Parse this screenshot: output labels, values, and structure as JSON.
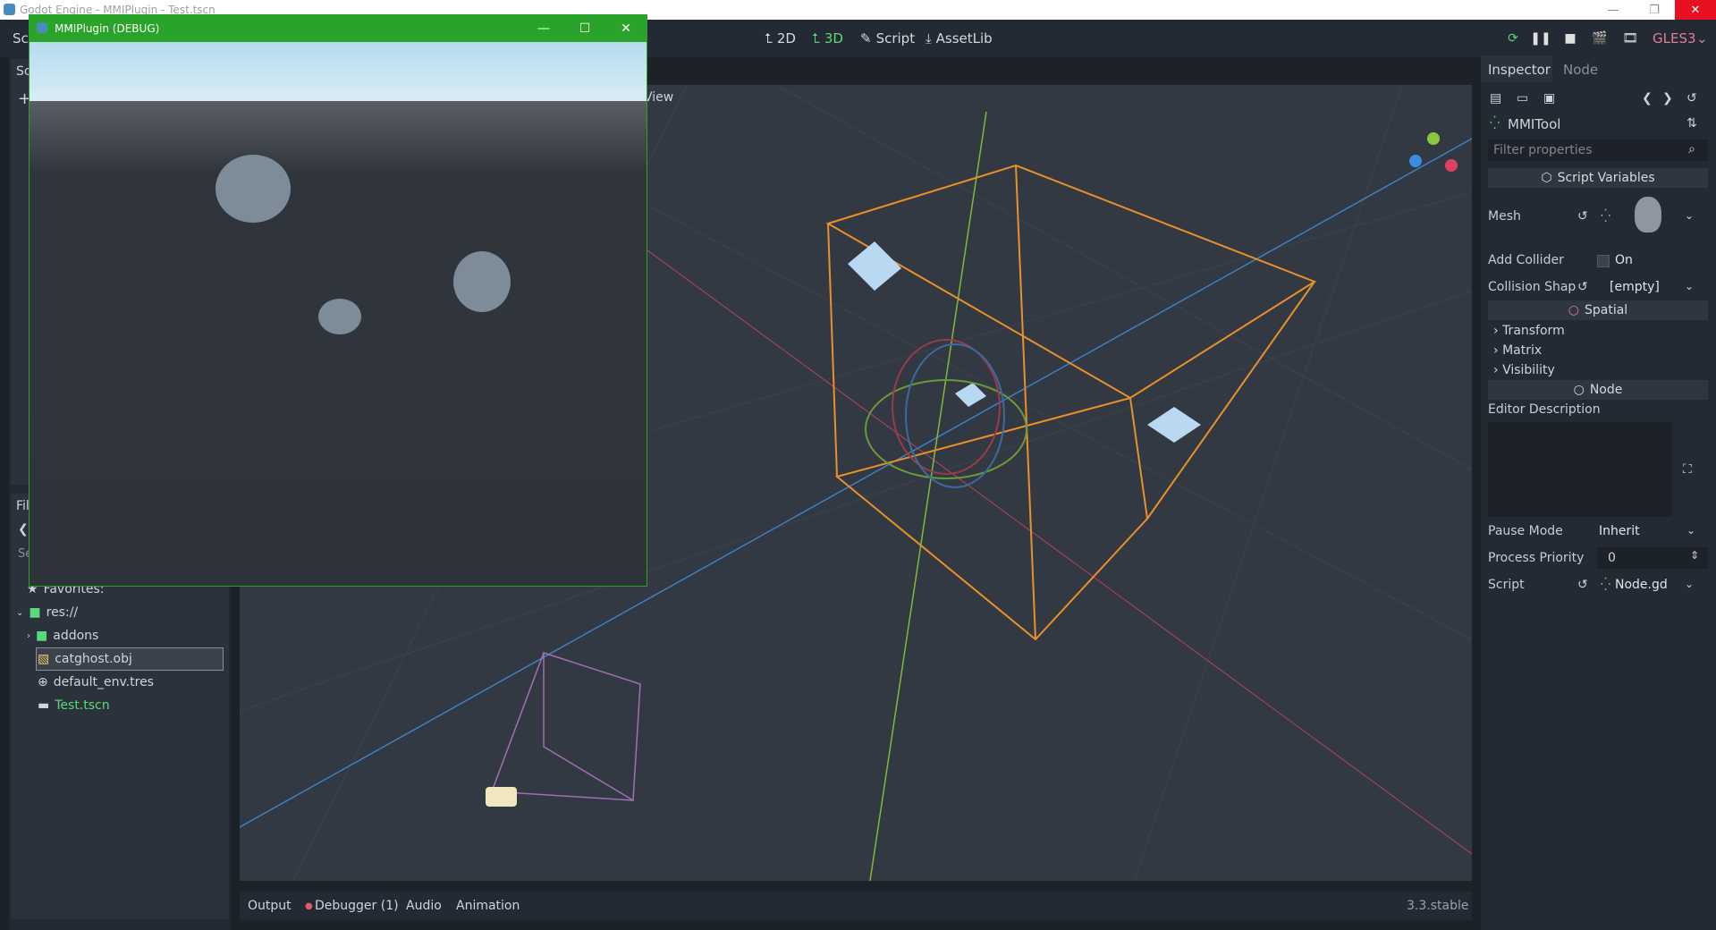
{
  "os_window": {
    "title": "Godot Engine - MMIPlugin - Test.tscn",
    "min": "—",
    "max": "❐",
    "close": "✕"
  },
  "topbar": {
    "menu_left": "Sc",
    "workspaces": [
      {
        "label": "2D",
        "icon": "2d-icon"
      },
      {
        "label": "3D",
        "icon": "3d-icon"
      },
      {
        "label": "Script",
        "icon": "script-icon"
      },
      {
        "label": "AssetLib",
        "icon": "assetlib-icon"
      }
    ],
    "renderer": "GLES3",
    "accent": "#5ad87a"
  },
  "left_dock": {
    "scene_tab": "Sc",
    "filesystem_tab": "Fil",
    "search_placeholder": "Se",
    "favorites": "Favorites:",
    "tree": [
      {
        "label": "res://",
        "type": "folder"
      },
      {
        "label": "addons",
        "type": "folder"
      },
      {
        "label": "catghost.obj",
        "type": "mesh",
        "selected": true
      },
      {
        "label": "default_env.tres",
        "type": "env"
      },
      {
        "label": "Test.tscn",
        "type": "scene",
        "color": "#5ad87a"
      }
    ]
  },
  "viewport": {
    "view_label": "View"
  },
  "bottom": {
    "tabs": [
      "Output",
      "Debugger (1)",
      "Audio",
      "Animation"
    ],
    "version": "3.3.stable"
  },
  "inspector": {
    "tabs": [
      "Inspector",
      "Node"
    ],
    "node_name": "MMITool",
    "filter_placeholder": "Filter properties",
    "script_variables": "Script Variables",
    "mesh_label": "Mesh",
    "add_collider_label": "Add Collider",
    "add_collider_value": "On",
    "collision_shape_label": "Collision Shap",
    "collision_shape_value": "[empty]",
    "spatial_section": "Spatial",
    "folds": [
      "Transform",
      "Matrix",
      "Visibility"
    ],
    "node_section": "Node",
    "editor_description": "Editor Description",
    "pause_mode_label": "Pause Mode",
    "pause_mode_value": "Inherit",
    "process_priority_label": "Process Priority",
    "process_priority_value": "0",
    "script_label": "Script",
    "script_value": "Node.gd"
  },
  "debug_window": {
    "title": "MMIPlugin (DEBUG)"
  }
}
